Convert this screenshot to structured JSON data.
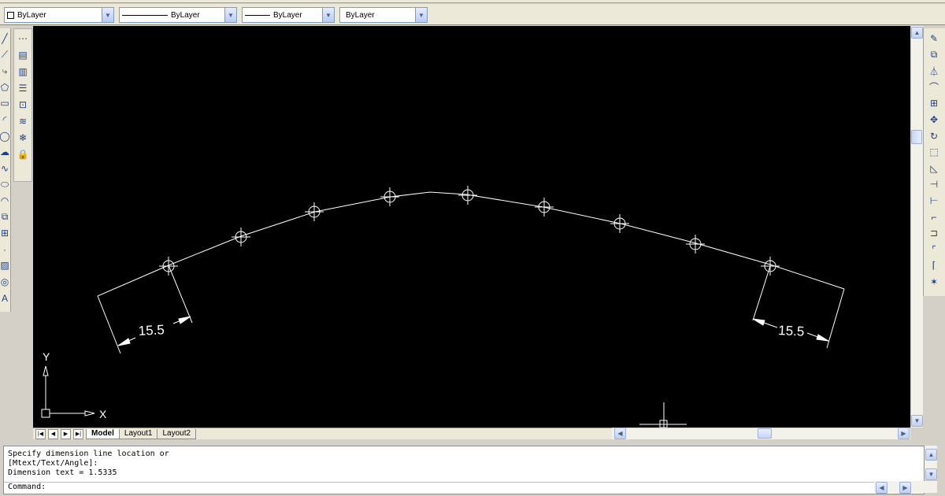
{
  "properties_toolbar": {
    "color": {
      "value": "ByLayer",
      "icon": "color-swatch-icon"
    },
    "linetype": {
      "value": "ByLayer"
    },
    "lineweight": {
      "value": "ByLayer"
    },
    "plotstyle": {
      "value": "ByLayer"
    }
  },
  "drawing": {
    "background": "#000000",
    "stroke": "#ffffff",
    "dimension_left": "15.5",
    "dimension_right": "15.5",
    "ucs_x_label": "X",
    "ucs_y_label": "Y"
  },
  "layout_tabs": {
    "tabs": [
      {
        "label": "Model",
        "active": true
      },
      {
        "label": "Layout1",
        "active": false
      },
      {
        "label": "Layout2",
        "active": false
      }
    ]
  },
  "command_window": {
    "history": [
      "Specify dimension line location or",
      "[Mtext/Text/Angle]:",
      "Dimension text = 1.5335"
    ],
    "prompt": "Command:"
  },
  "icons": {
    "left_draw": [
      "line-icon",
      "construction-line-icon",
      "polyline-icon",
      "polygon-icon",
      "rectangle-icon",
      "arc-icon",
      "circle-icon",
      "revision-cloud-icon",
      "spline-icon",
      "ellipse-icon",
      "ellipse-arc-icon",
      "insert-block-icon",
      "make-block-icon",
      "point-icon",
      "hatch-icon",
      "region-icon",
      "mtext-icon"
    ],
    "left_properties": [
      "match-properties-icon",
      "layer-properties-icon",
      "layer-previous-icon",
      "layer-state-icon",
      "design-center-icon",
      "layers-icon",
      "layer-freeze-icon",
      "layer-lock-icon"
    ],
    "right_modify": [
      "erase-icon",
      "copy-icon",
      "mirror-icon",
      "offset-icon",
      "array-icon",
      "move-icon",
      "rotate-icon",
      "scale-icon",
      "stretch-icon",
      "trim-icon",
      "extend-icon",
      "break-at-point-icon",
      "break-icon",
      "chamfer-icon",
      "fillet-icon",
      "explode-icon"
    ]
  }
}
